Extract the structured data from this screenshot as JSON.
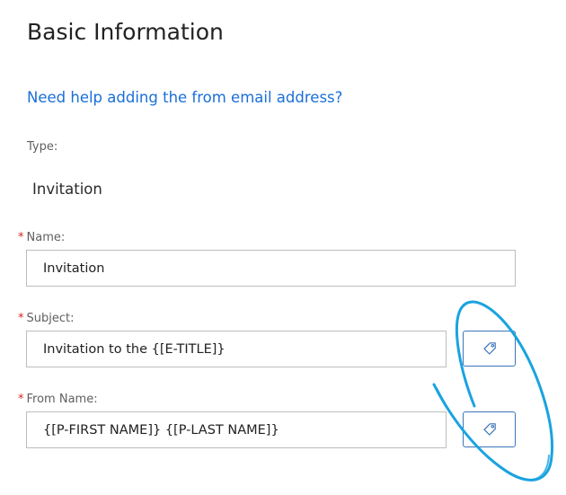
{
  "header": {
    "title": "Basic Information"
  },
  "help": {
    "link_text": "Need help adding the from email address?"
  },
  "type_field": {
    "label": "Type:",
    "value": "Invitation"
  },
  "name_field": {
    "required_mark": "*",
    "label": "Name:",
    "value": "Invitation"
  },
  "subject_field": {
    "required_mark": "*",
    "label": "Subject:",
    "value": "Invitation to the {[E-TITLE]}",
    "merge_tag_icon": "tag-icon"
  },
  "from_name_field": {
    "required_mark": "*",
    "label": "From Name:",
    "value": "{[P-FIRST NAME]} {[P-LAST NAME]}",
    "merge_tag_icon": "tag-icon"
  },
  "colors": {
    "link": "#1a6fd8",
    "required": "#d9261c",
    "button_border": "#3b74b8",
    "annotation": "#1aa3e0"
  }
}
